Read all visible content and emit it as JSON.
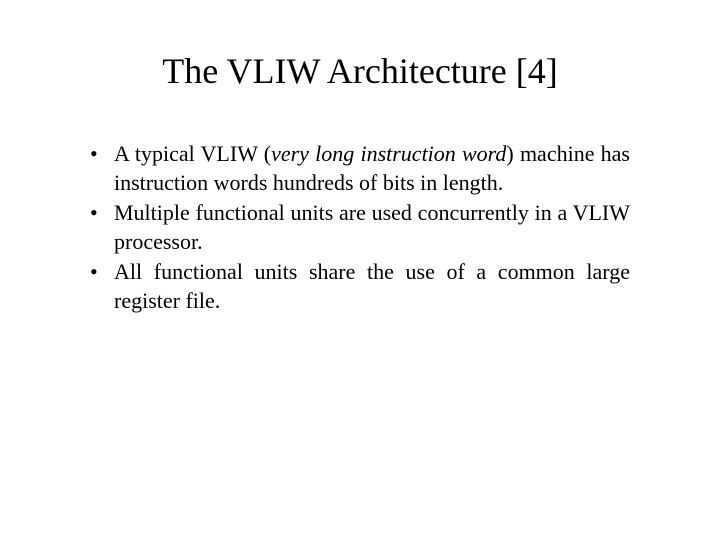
{
  "title": "The VLIW Architecture [4]",
  "bullets": {
    "b0_pre": "A typical VLIW (",
    "b0_italic": "very long instruction word",
    "b0_post": ") machine has instruction words hundreds of bits in length.",
    "b1": "Multiple functional units are used concurrently in a VLIW processor.",
    "b2": "All functional units share the use of a common large register file."
  }
}
